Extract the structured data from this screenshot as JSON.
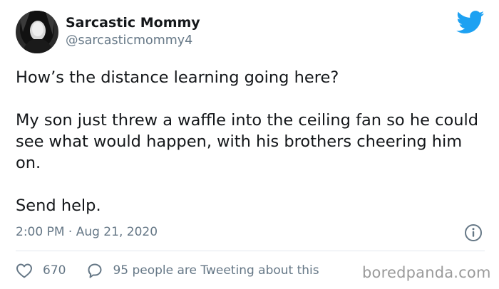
{
  "tweet": {
    "display_name": "Sarcastic Mommy",
    "handle": "@sarcasticmommy4",
    "paragraphs": [
      "How’s the distance learning going here?",
      "My son just threw a waffle into the ceiling fan so he could see what would happen, with his brothers cheering him on.",
      "Send help."
    ],
    "timestamp": "2:00 PM · Aug 21, 2020",
    "like_count": "670",
    "reply_text": "95 people are Tweeting about this"
  },
  "watermark": "boredpanda.com",
  "icons": {
    "brand": "twitter-bird-icon",
    "info": "info-icon",
    "like": "heart-icon",
    "reply": "speech-bubble-icon"
  },
  "colors": {
    "twitter_blue": "#1da1f2",
    "secondary_text": "#657786",
    "primary_text": "#14171a",
    "divider": "#e1e8ed"
  }
}
